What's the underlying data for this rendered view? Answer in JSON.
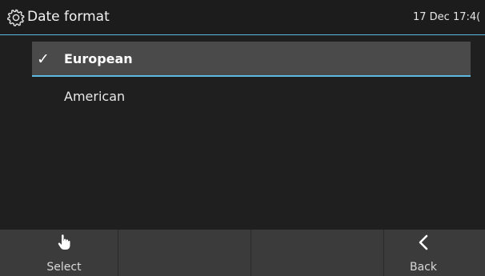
{
  "header": {
    "icon": "gear-icon",
    "title": "Date format",
    "clock": "17 Dec 17:4("
  },
  "menu": {
    "items": [
      {
        "label": "European",
        "selected": true,
        "check": "✓"
      },
      {
        "label": "American",
        "selected": false
      }
    ]
  },
  "softkeys": [
    {
      "label": "Select",
      "icon": "hand-pointer-icon"
    },
    {
      "label": ""
    },
    {
      "label": ""
    },
    {
      "label": "Back",
      "icon": "chevron-left-icon"
    }
  ],
  "colors": {
    "accent": "#5fb8e0",
    "background": "#1f1f1f",
    "selected_row": "#4a4a4a",
    "softkey_bar": "#3b3b3b"
  }
}
